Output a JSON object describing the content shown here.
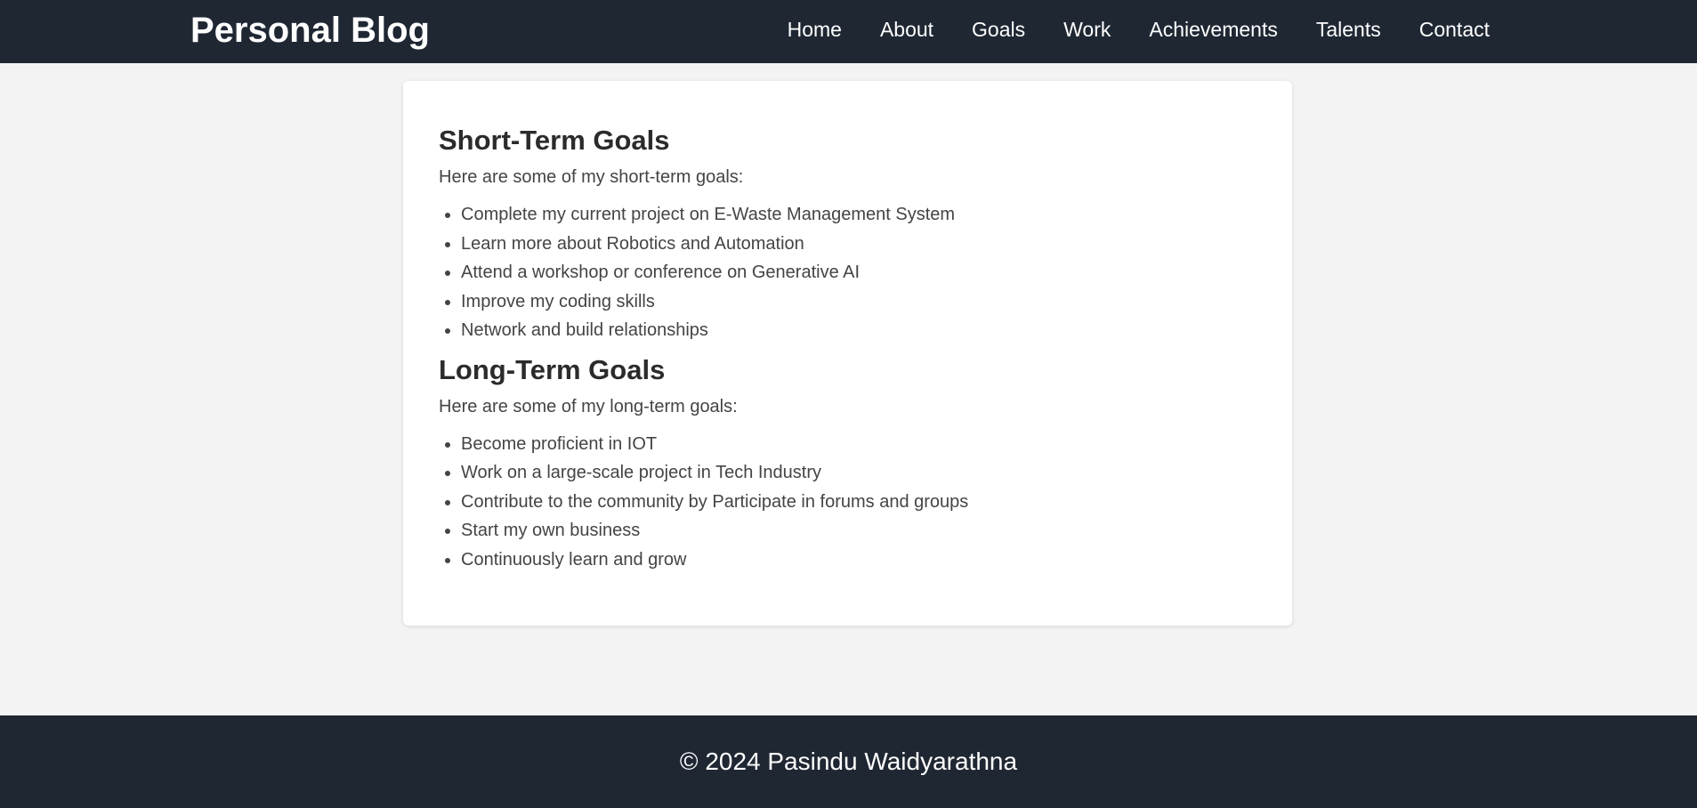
{
  "header": {
    "logo": "Personal Blog",
    "nav": [
      {
        "label": "Home"
      },
      {
        "label": "About"
      },
      {
        "label": "Goals"
      },
      {
        "label": "Work"
      },
      {
        "label": "Achievements"
      },
      {
        "label": "Talents"
      },
      {
        "label": "Contact"
      }
    ]
  },
  "short_term": {
    "title": "Short-Term Goals",
    "intro": "Here are some of my short-term goals:",
    "items": [
      "Complete my current project on E-Waste Management System",
      "Learn more about Robotics and Automation",
      "Attend a workshop or conference on Generative AI",
      "Improve my coding skills",
      "Network and build relationships"
    ]
  },
  "long_term": {
    "title": "Long-Term Goals",
    "intro": "Here are some of my long-term goals:",
    "items": [
      "Become proficient in IOT",
      "Work on a large-scale project in Tech Industry",
      "Contribute to the community by Participate in forums and groups",
      "Start my own business",
      "Continuously learn and grow"
    ]
  },
  "footer": {
    "copyright": "© 2024 Pasindu Waidyarathna"
  }
}
